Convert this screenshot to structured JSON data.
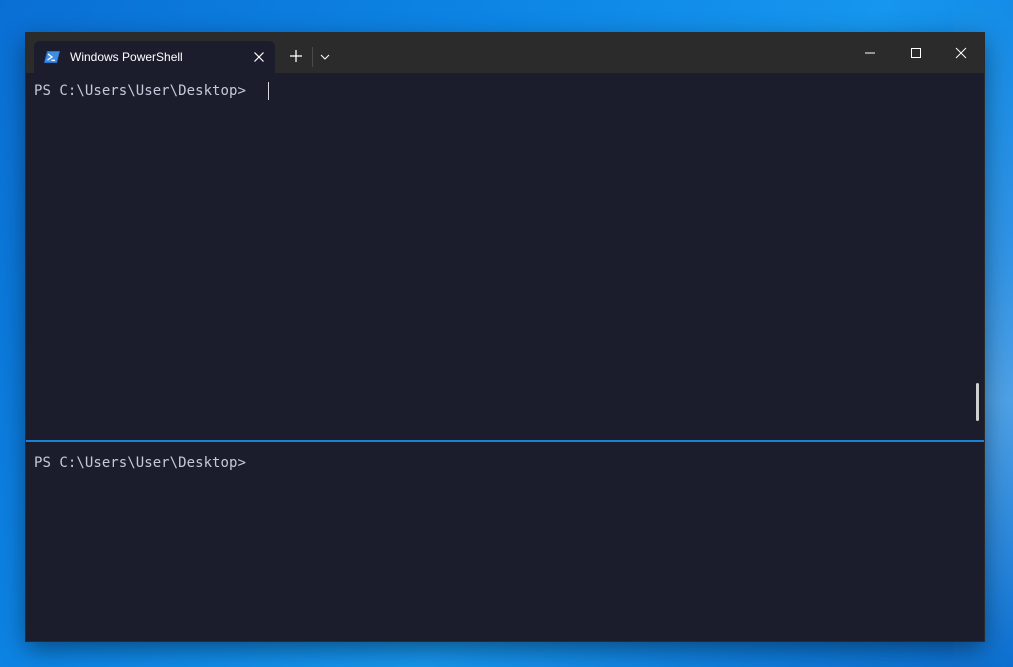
{
  "window": {
    "tab_title": "Windows PowerShell"
  },
  "icons": {
    "tab": "powershell-icon",
    "tab_close": "close-icon",
    "new_tab": "plus-icon",
    "dropdown": "chevron-down-icon",
    "minimize": "minimize-icon",
    "maximize": "maximize-icon",
    "close": "close-icon"
  },
  "panes": [
    {
      "prompt": "PS C:\\Users\\User\\Desktop>"
    },
    {
      "prompt": "PS C:\\Users\\User\\Desktop>"
    }
  ],
  "colors": {
    "terminal_background": "#1c1d2c",
    "titlebar": "#2b2b2b",
    "focus_divider": "#1a82d4",
    "text": "#c5c9dc"
  }
}
